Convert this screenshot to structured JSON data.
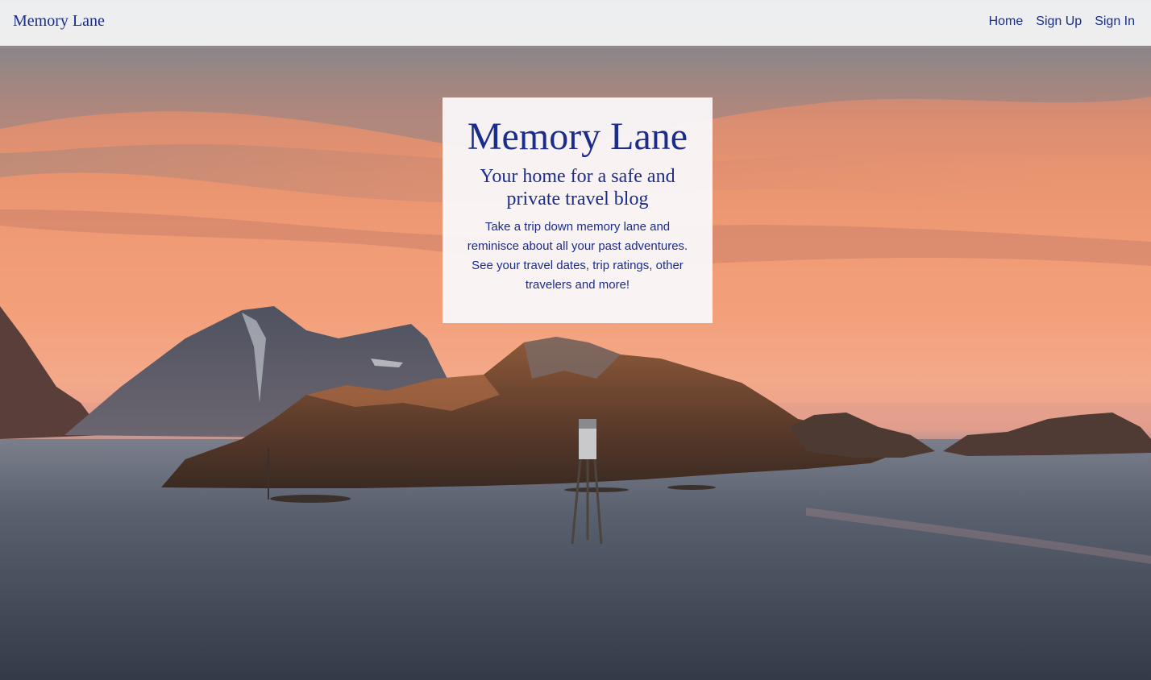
{
  "navbar": {
    "brand": "Memory Lane",
    "links": [
      {
        "label": "Home"
      },
      {
        "label": "Sign Up"
      },
      {
        "label": "Sign In"
      }
    ]
  },
  "hero": {
    "title": "Memory Lane",
    "subtitle": "Your home for a safe and private travel blog",
    "description": "Take a trip down memory lane and reminisce about all your past adventures. See your travel dates, trip ratings, other travelers and more!"
  },
  "colors": {
    "accent": "#1a2c8c",
    "navbar_bg": "#f5f6f8",
    "card_bg": "#faf8fa"
  }
}
